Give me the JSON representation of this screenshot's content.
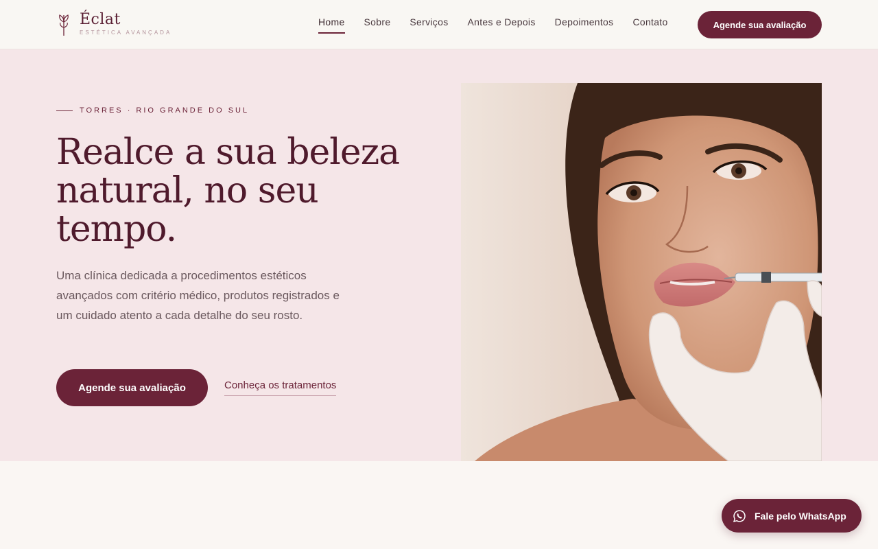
{
  "brand": {
    "name": "Éclat",
    "tagline": "ESTÉTICA AVANÇADA",
    "logo_icon": "sprout-icon"
  },
  "nav": {
    "items": [
      {
        "label": "Home",
        "active": true
      },
      {
        "label": "Sobre",
        "active": false
      },
      {
        "label": "Serviços",
        "active": false
      },
      {
        "label": "Antes e Depois",
        "active": false
      },
      {
        "label": "Depoimentos",
        "active": false
      },
      {
        "label": "Contato",
        "active": false
      }
    ],
    "cta_label": "Agende sua avaliação"
  },
  "hero": {
    "eyebrow": "TORRES · RIO GRANDE DO SUL",
    "headline": "Realce a sua beleza natural, no seu tempo.",
    "lead": "Uma clínica dedicada a procedimentos estéticos avançados com critério médico, produtos registrados e um cuidado atento a cada detalhe do seu rosto.",
    "primary_cta": "Agende sua avaliação",
    "secondary_link": "Conheça os tratamentos"
  },
  "whatsapp": {
    "label": "Fale pelo WhatsApp",
    "icon": "whatsapp-icon"
  },
  "colors": {
    "primary": "#6b2338",
    "hero_bg": "#f5e6e8",
    "page_bg": "#faf6f3",
    "headline": "#4f1a2c"
  }
}
